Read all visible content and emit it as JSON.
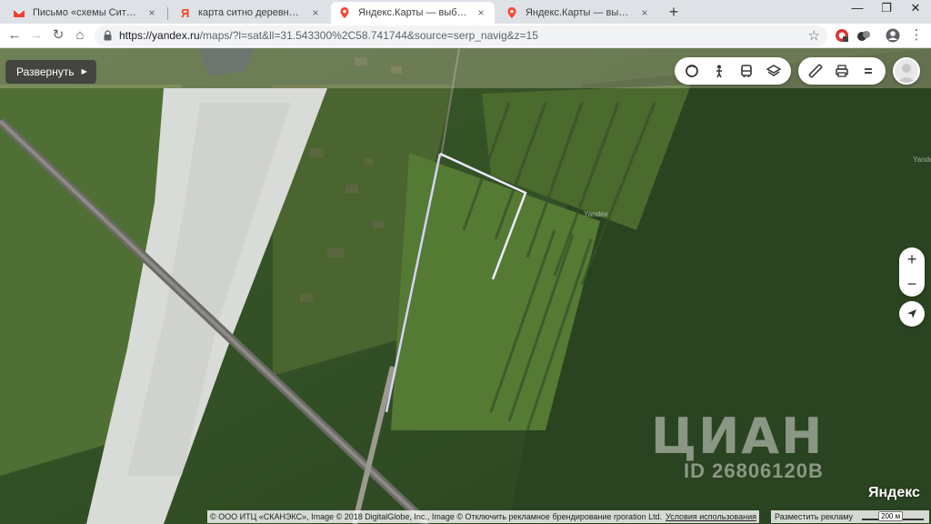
{
  "browser": {
    "tabs": [
      {
        "title": "Письмо «схемы Ситно» — илья",
        "favicon": "gmail-icon"
      },
      {
        "title": "карта ситно деревня великий н",
        "favicon": "yandex-icon"
      },
      {
        "title": "Яндекс.Карты — выбирайте, гд",
        "favicon": "yandex-maps-pin-icon"
      },
      {
        "title": "Яндекс.Карты — выбирайте, гд",
        "favicon": "yandex-maps-pin-icon"
      }
    ],
    "close_glyph": "×",
    "new_tab_glyph": "+",
    "window_controls": {
      "minimize": "—",
      "restore": "❐",
      "close": "✕"
    },
    "url_host": "https://yandex.ru",
    "url_path": "/maps/?l=sat&ll=31.543300%2C58.741744&source=serp_navig&z=15",
    "icons": {
      "back": "←",
      "forward": "→",
      "reload": "↻",
      "home": "⌂",
      "star": "☆",
      "menu": "⋮"
    }
  },
  "map": {
    "expand_label": "Развернуть",
    "expand_arrow": "▶",
    "zoom_in": "+",
    "zoom_out": "−",
    "place_labels": [
      "Yandex",
      "Yandex"
    ],
    "watermark_brand": "ЦИАН",
    "watermark_id": "ID 26806120В",
    "yandex_logo": "Яндекс",
    "copyright_text": "© ООО ИТЦ «СКАНЭКС», Image © 2018 DigitalGlobe, Inc., Image © Отключить рекламное брендирование rporation Ltd.",
    "terms_link": "Условия использования",
    "advertise_link": "Разместить рекламу",
    "scale_label": "200 м",
    "colors": {
      "forest": "#2f4a22",
      "field": "#4a6a30",
      "river": "#d8dad6",
      "boundary": "#e6e6ff"
    }
  }
}
